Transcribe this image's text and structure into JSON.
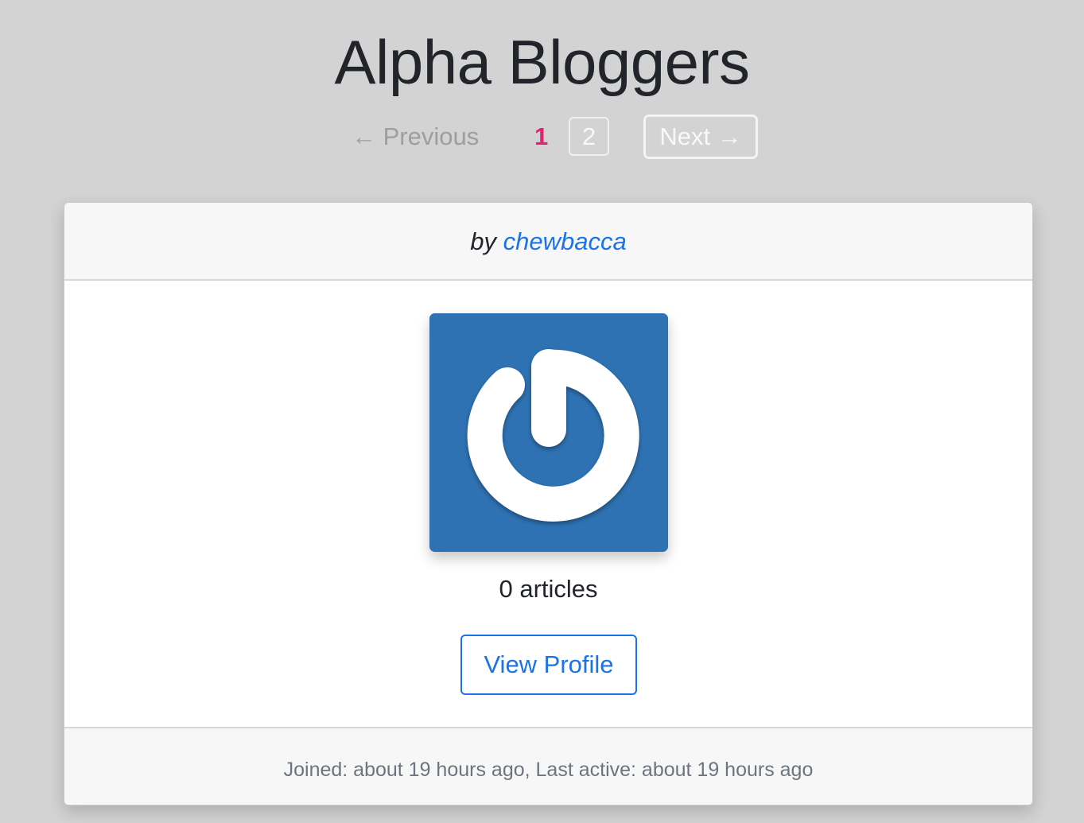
{
  "page": {
    "title": "Alpha Bloggers"
  },
  "pagination": {
    "previous_label": "← Previous",
    "current_page": "1",
    "pages": [
      "2"
    ],
    "next_label": "Next →"
  },
  "blogger": {
    "by_prefix": "by",
    "username": "chewbacca",
    "avatar_icon": "gravatar-default-icon",
    "avatar_color": "#2e72b3",
    "articles_count": "0 articles",
    "view_profile_label": "View Profile",
    "footer_text": "Joined: about 19 hours ago, Last active: about 19 hours ago"
  },
  "colors": {
    "background": "#d3d3d3",
    "link": "#1a73e8",
    "current_page": "#e0236f"
  }
}
